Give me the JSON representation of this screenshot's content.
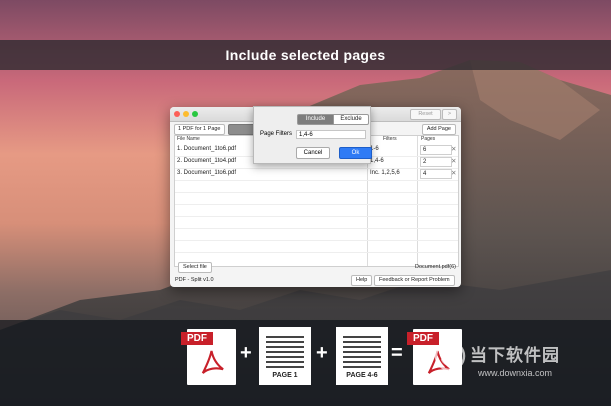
{
  "banner": {
    "title": "Include selected pages"
  },
  "window": {
    "toolbar": {
      "reset_label": "Reset",
      "next_label": ">"
    },
    "tabs": [
      {
        "label": "1 PDF for 1 Page"
      },
      {
        "label": ""
      }
    ],
    "add_page_label": "Add Page",
    "table": {
      "headers": {
        "file_name": "File Name",
        "filters": "Filters",
        "pages": "Pages"
      },
      "rows": [
        {
          "file": "1. Document_1to6.pdf",
          "filter": "1-6",
          "pages": "6"
        },
        {
          "file": "2. Document_1to4.pdf",
          "filter": "1,4-6",
          "pages": "2"
        },
        {
          "file": "3. Document_1to6.pdf",
          "filter": "Inc. 1,2,5,6",
          "pages": "4"
        }
      ]
    },
    "select_file_label": "Select file",
    "output_file": "Document.pdf(6)",
    "app_name": "PDF - Split v1.0",
    "help_label": "Help",
    "feedback_label": "Feedback or Report Problem"
  },
  "sheet": {
    "include_label": "Include",
    "exclude_label": "Exclude",
    "page_filters_label": "Page Filters",
    "page_filters_value": "1,4-6",
    "cancel_label": "Cancel",
    "ok_label": "Ok"
  },
  "strip": {
    "pdf_label": "PDF",
    "page1_label": "PAGE 1",
    "page46_label": "PAGE 4-6",
    "plus": "+",
    "equals": "="
  },
  "watermark": {
    "cn": "当下软件园",
    "url": "www.downxia.com"
  },
  "colors": {
    "accent_blue": "#2f7bf5",
    "pdf_red": "#c8202a",
    "banner_bg": "#322c32"
  }
}
